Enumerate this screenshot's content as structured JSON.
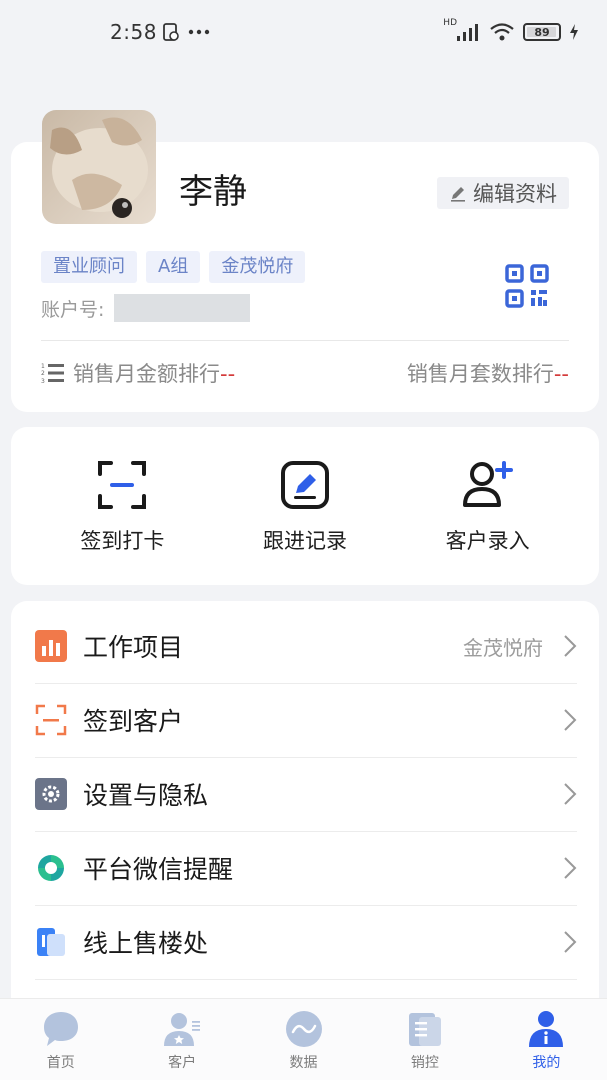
{
  "status_bar": {
    "time": "2:58",
    "battery": "89",
    "network": "HD"
  },
  "profile": {
    "name": "李静",
    "edit_label": "编辑资料",
    "tags": [
      "置业顾问",
      "A组",
      "金茂悦府"
    ],
    "account_label": "账户号:",
    "rank_amount_label": "销售月金额排行",
    "rank_amount_value": "--",
    "rank_count_label": "销售月套数排行",
    "rank_count_value": "--"
  },
  "actions": [
    {
      "label": "签到打卡",
      "icon": "scan-icon"
    },
    {
      "label": "跟进记录",
      "icon": "edit-record-icon"
    },
    {
      "label": "客户录入",
      "icon": "add-user-icon"
    }
  ],
  "menu": [
    {
      "label": "工作项目",
      "value": "金茂悦府",
      "icon": "chart-icon"
    },
    {
      "label": "签到客户",
      "value": "",
      "icon": "scan-icon"
    },
    {
      "label": "设置与隐私",
      "value": "",
      "icon": "gear-icon"
    },
    {
      "label": "平台微信提醒",
      "value": "",
      "icon": "refresh-icon"
    },
    {
      "label": "线上售楼处",
      "value": "",
      "icon": "building-icon"
    }
  ],
  "nav": [
    {
      "label": "首页",
      "icon": "chat-icon"
    },
    {
      "label": "客户",
      "icon": "customer-icon"
    },
    {
      "label": "数据",
      "icon": "data-icon"
    },
    {
      "label": "销控",
      "icon": "document-icon"
    },
    {
      "label": "我的",
      "icon": "profile-icon"
    }
  ],
  "colors": {
    "accent": "#2f5fe8",
    "tag_text": "#6b84c7",
    "rank_dash": "#d43a3a"
  }
}
